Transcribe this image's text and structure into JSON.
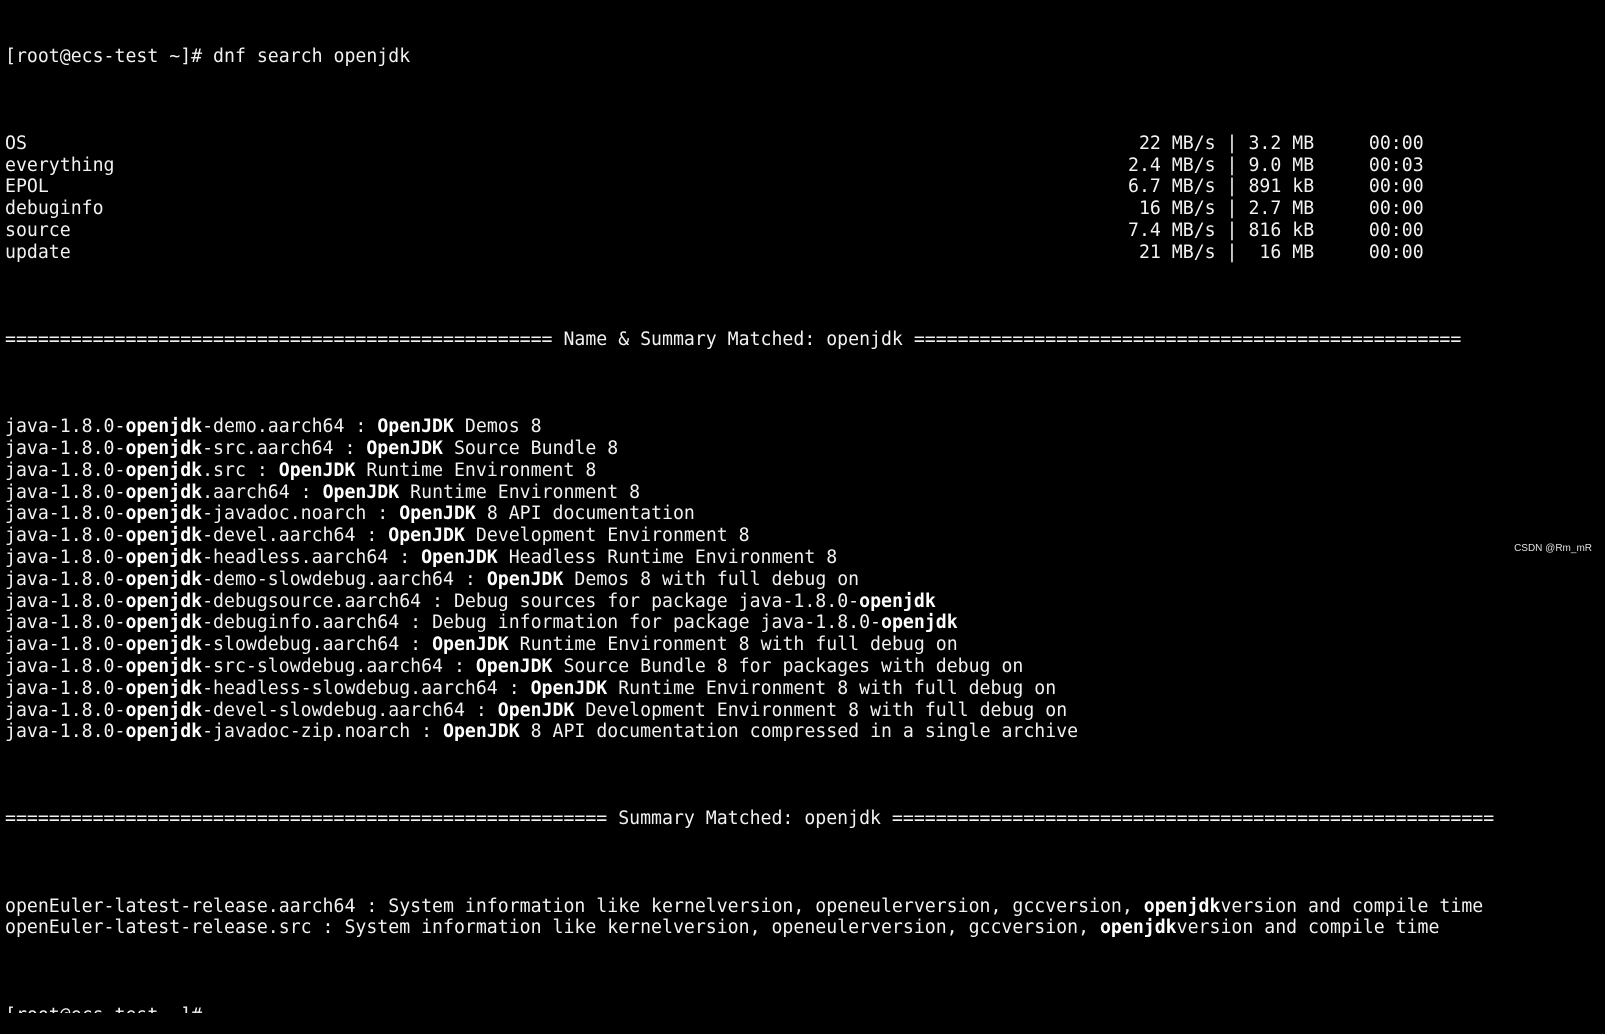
{
  "prompt_line": "[root@ecs-test ~]# dnf search openjdk",
  "repos": [
    {
      "name": "OS",
      "stats": " 22 MB/s | 3.2 MB     00:00"
    },
    {
      "name": "everything",
      "stats": "2.4 MB/s | 9.0 MB     00:03"
    },
    {
      "name": "EPOL",
      "stats": "6.7 MB/s | 891 kB     00:00"
    },
    {
      "name": "debuginfo",
      "stats": " 16 MB/s | 2.7 MB     00:00"
    },
    {
      "name": "source",
      "stats": "7.4 MB/s | 816 kB     00:00"
    },
    {
      "name": "update",
      "stats": " 21 MB/s |  16 MB     00:00"
    }
  ],
  "separator_name_summary": "================================================== Name & Summary Matched: openjdk ==================================================",
  "name_summary_results": [
    {
      "pre": "java-1.8.0-",
      "match": "openjdk",
      "post": "-demo.aarch64 : ",
      "bold_desc": "OpenJDK",
      "desc": " Demos 8",
      "tail_bold": ""
    },
    {
      "pre": "java-1.8.0-",
      "match": "openjdk",
      "post": "-src.aarch64 : ",
      "bold_desc": "OpenJDK",
      "desc": " Source Bundle 8",
      "tail_bold": ""
    },
    {
      "pre": "java-1.8.0-",
      "match": "openjdk",
      "post": ".src : ",
      "bold_desc": "OpenJDK",
      "desc": " Runtime Environment 8",
      "tail_bold": ""
    },
    {
      "pre": "java-1.8.0-",
      "match": "openjdk",
      "post": ".aarch64 : ",
      "bold_desc": "OpenJDK",
      "desc": " Runtime Environment 8",
      "tail_bold": ""
    },
    {
      "pre": "java-1.8.0-",
      "match": "openjdk",
      "post": "-javadoc.noarch : ",
      "bold_desc": "OpenJDK",
      "desc": " 8 API documentation",
      "tail_bold": ""
    },
    {
      "pre": "java-1.8.0-",
      "match": "openjdk",
      "post": "-devel.aarch64 : ",
      "bold_desc": "OpenJDK",
      "desc": " Development Environment 8",
      "tail_bold": ""
    },
    {
      "pre": "java-1.8.0-",
      "match": "openjdk",
      "post": "-headless.aarch64 : ",
      "bold_desc": "OpenJDK",
      "desc": " Headless Runtime Environment 8",
      "tail_bold": ""
    },
    {
      "pre": "java-1.8.0-",
      "match": "openjdk",
      "post": "-demo-slowdebug.aarch64 : ",
      "bold_desc": "OpenJDK",
      "desc": " Demos 8 with full debug on",
      "tail_bold": ""
    },
    {
      "pre": "java-1.8.0-",
      "match": "openjdk",
      "post": "-debugsource.aarch64 : ",
      "bold_desc": "",
      "desc": "Debug sources for package java-1.8.0-",
      "tail_bold": "openjdk"
    },
    {
      "pre": "java-1.8.0-",
      "match": "openjdk",
      "post": "-debuginfo.aarch64 : ",
      "bold_desc": "",
      "desc": "Debug information for package java-1.8.0-",
      "tail_bold": "openjdk"
    },
    {
      "pre": "java-1.8.0-",
      "match": "openjdk",
      "post": "-slowdebug.aarch64 : ",
      "bold_desc": "OpenJDK",
      "desc": " Runtime Environment 8 with full debug on",
      "tail_bold": ""
    },
    {
      "pre": "java-1.8.0-",
      "match": "openjdk",
      "post": "-src-slowdebug.aarch64 : ",
      "bold_desc": "OpenJDK",
      "desc": " Source Bundle 8 for packages with debug on",
      "tail_bold": ""
    },
    {
      "pre": "java-1.8.0-",
      "match": "openjdk",
      "post": "-headless-slowdebug.aarch64 : ",
      "bold_desc": "OpenJDK",
      "desc": " Runtime Environment 8 with full debug on",
      "tail_bold": ""
    },
    {
      "pre": "java-1.8.0-",
      "match": "openjdk",
      "post": "-devel-slowdebug.aarch64 : ",
      "bold_desc": "OpenJDK",
      "desc": " Development Environment 8 with full debug on",
      "tail_bold": ""
    },
    {
      "pre": "java-1.8.0-",
      "match": "openjdk",
      "post": "-javadoc-zip.noarch : ",
      "bold_desc": "OpenJDK",
      "desc": " 8 API documentation compressed in a single archive",
      "tail_bold": ""
    }
  ],
  "separator_summary": "======================================================= Summary Matched: openjdk =======================================================",
  "summary_results": [
    {
      "pkg": "openEuler-latest-release.aarch64 : System information like kernelversion, openeulerversion, gccversion, ",
      "match": "openjdk",
      "post": "version and compile time"
    },
    {
      "pkg": "openEuler-latest-release.src : System information like kernelversion, openeulerversion, gccversion, ",
      "match": "openjdk",
      "post": "version and compile time"
    }
  ],
  "cutoff_line": "[root@ecs-test ~]# ",
  "watermark": "CSDN @Rm_mR"
}
